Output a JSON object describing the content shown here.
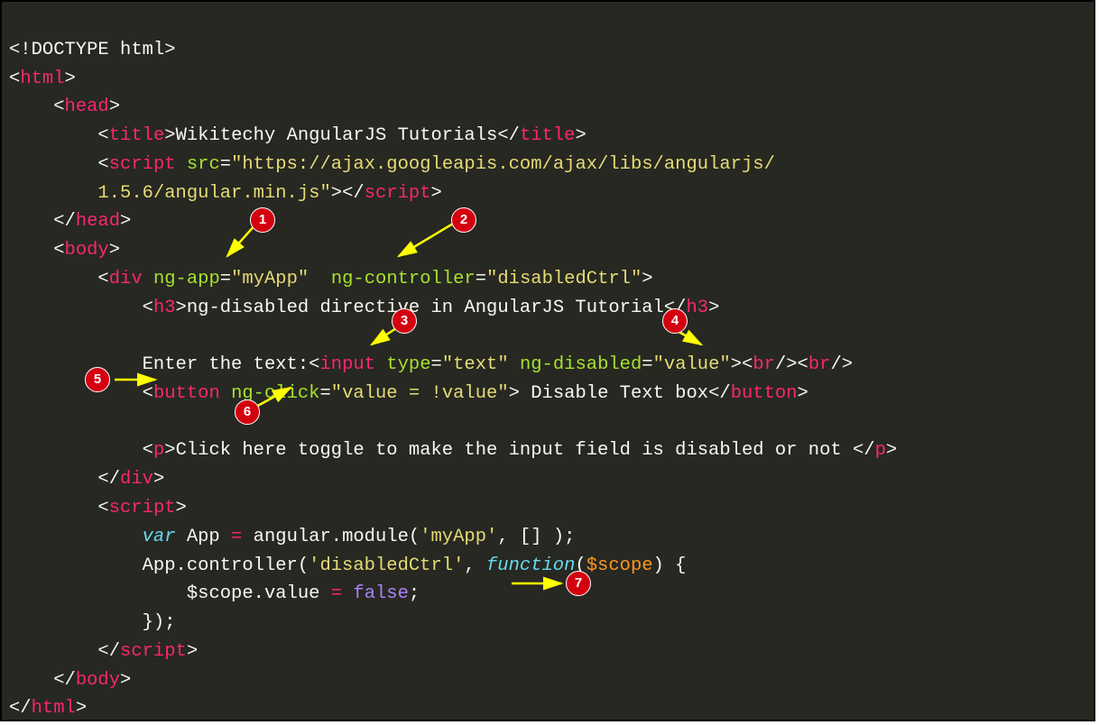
{
  "code": {
    "l1_doctype": "<!DOCTYPE html>",
    "l2_open": "<",
    "l2_tag": "html",
    "l2_close": ">",
    "l3_open": "<",
    "l3_tag": "head",
    "l3_close": ">",
    "l4_open": "<",
    "l4_tag": "title",
    "l4_close": ">",
    "l4_text": "Wikitechy AngularJS Tutorials",
    "l4_copen": "</",
    "l4_cclose": ">",
    "l5_open": "<",
    "l5_tag": "script",
    "l5_attr": "src",
    "l5_eq": "=",
    "l5_val": "\"https://ajax.googleapis.com/ajax/libs/angularjs/",
    "l6_val": "1.5.6/angular.min.js\"",
    "l6_close": ">",
    "l6_copen": "</",
    "l6_ctag": "script",
    "l6_cclose": ">",
    "l7_open": "</",
    "l7_tag": "head",
    "l7_close": ">",
    "l8_open": "<",
    "l8_tag": "body",
    "l8_close": ">",
    "l9_open": "<",
    "l9_tag": "div",
    "l9_attr1": "ng-app",
    "l9_eq1": "=",
    "l9_val1": "\"myApp\"",
    "l9_attr2": "ng-controller",
    "l9_eq2": "=",
    "l9_val2": "\"disabledCtrl\"",
    "l9_close": ">",
    "l10_open": "<",
    "l10_tag": "h3",
    "l10_close": ">",
    "l10_text": "ng-disabled directive in AngularJS Tutorial",
    "l10_copen": "</",
    "l10_cclose": ">",
    "l11_text": "Enter the text:",
    "l11_open": "<",
    "l11_tag": "input",
    "l11_attr1": "type",
    "l11_eq1": "=",
    "l11_val1": "\"text\"",
    "l11_attr2": "ng-disabled",
    "l11_eq2": "=",
    "l11_val2": "\"value\"",
    "l11_close": ">",
    "l11_br": "<br/><br/>",
    "l12_open": "<",
    "l12_tag": "button",
    "l12_attr": "ng-click",
    "l12_eq": "=",
    "l12_val": "\"value = !value\"",
    "l12_close": ">",
    "l12_text": " Disable Text box",
    "l12_copen": "</",
    "l12_cclose": ">",
    "l13_open": "<",
    "l13_tag": "p",
    "l13_close": ">",
    "l13_text": "Click here toggle to make the input field is disabled or not ",
    "l13_copen": "</",
    "l13_cclose": ">",
    "l14_open": "</",
    "l14_tag": "div",
    "l14_close": ">",
    "l15_open": "<",
    "l15_tag": "script",
    "l15_close": ">",
    "l16_var": "var",
    "l16_name": " App ",
    "l16_op": "=",
    "l16_text": " angular.module(",
    "l16_str": "'myApp'",
    "l16_text2": ", [] );",
    "l17_text1": "App.controller(",
    "l17_str": "'disabledCtrl'",
    "l17_text2": ", ",
    "l17_func": "function",
    "l17_text3": "(",
    "l17_scope": "$scope",
    "l17_text4": ") {",
    "l18_scope": "$scope",
    "l18_text1": ".value ",
    "l18_op": "=",
    "l18_text2": " ",
    "l18_bool": "false",
    "l18_text3": ";",
    "l19_text": "});",
    "l20_open": "</",
    "l20_tag": "script",
    "l20_close": ">",
    "l21_open": "</",
    "l21_tag": "body",
    "l21_close": ">",
    "l22_open": "</",
    "l22_tag": "html",
    "l22_close": ">"
  },
  "badges": {
    "b1": "1",
    "b2": "2",
    "b3": "3",
    "b4": "4",
    "b5": "5",
    "b6": "6",
    "b7": "7"
  }
}
